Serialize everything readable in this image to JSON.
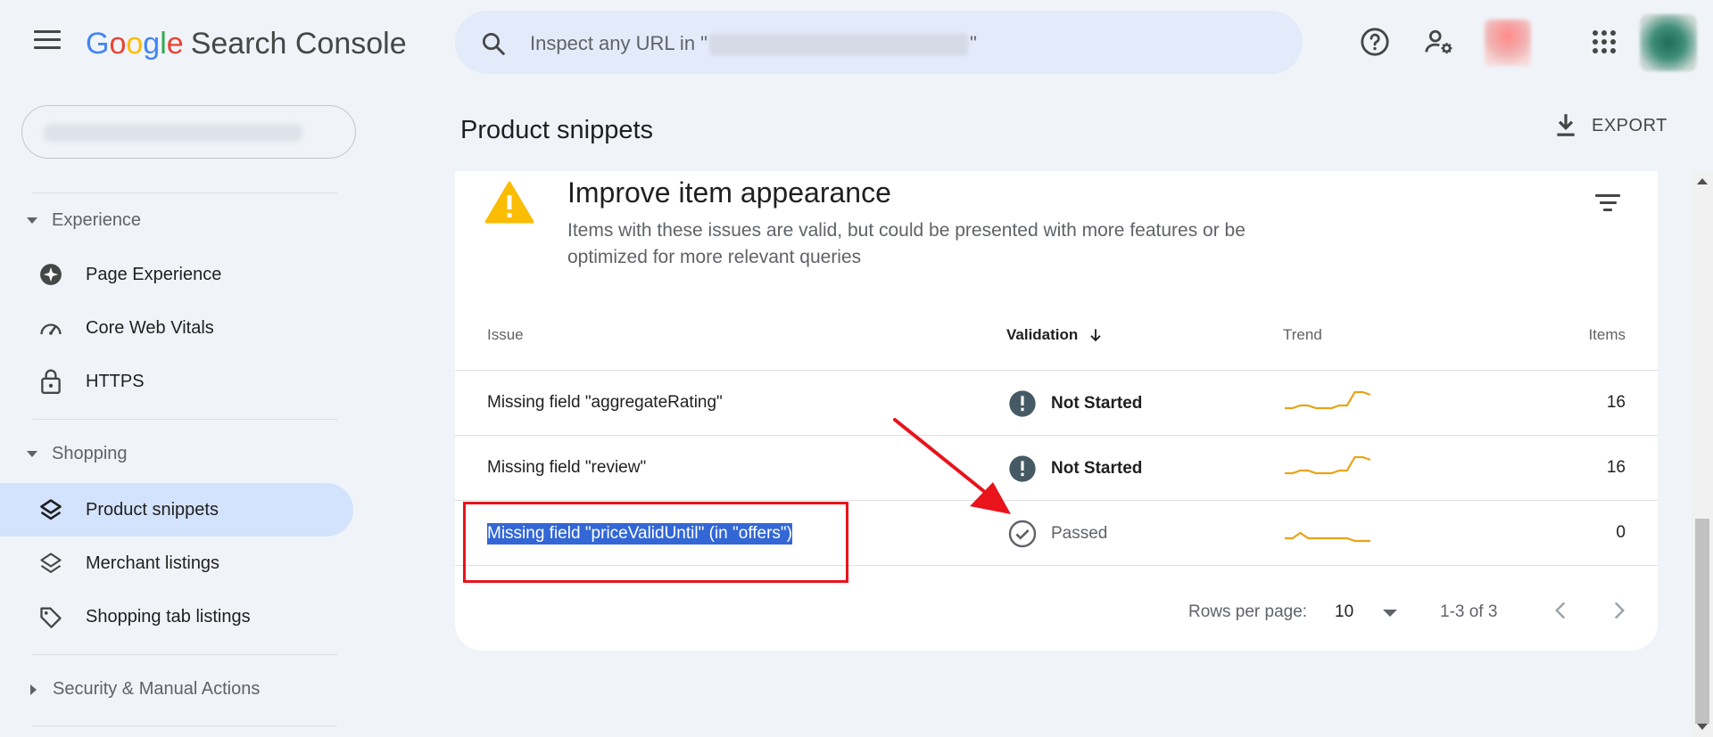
{
  "header": {
    "logo_google_letters": [
      "G",
      "o",
      "o",
      "g",
      "l",
      "e"
    ],
    "product_name": "Search Console",
    "search_placeholder_prefix": "Inspect any URL in \"",
    "search_placeholder_suffix": "\"",
    "icons": [
      "menu-icon",
      "search-icon",
      "help-icon",
      "manage-account-icon",
      "apps-icon"
    ]
  },
  "sidebar": {
    "sections": [
      {
        "label": "Experience",
        "expanded": true
      },
      {
        "label": "Shopping",
        "expanded": true
      },
      {
        "label": "Security & Manual Actions",
        "expanded": false
      }
    ],
    "items": [
      {
        "label": "Page Experience",
        "icon": "page-experience-icon",
        "active": false
      },
      {
        "label": "Core Web Vitals",
        "icon": "speedometer-icon",
        "active": false
      },
      {
        "label": "HTTPS",
        "icon": "lock-icon",
        "active": false
      },
      {
        "label": "Product snippets",
        "icon": "layers-icon",
        "active": true
      },
      {
        "label": "Merchant listings",
        "icon": "layers-outline-icon",
        "active": false
      },
      {
        "label": "Shopping tab listings",
        "icon": "tag-icon",
        "active": false
      }
    ]
  },
  "main": {
    "title": "Product snippets",
    "export_label": "EXPORT",
    "card": {
      "title": "Improve item appearance",
      "subtitle": "Items with these issues are valid, but could be presented with more features or be optimized for more relevant queries",
      "columns": {
        "issue": "Issue",
        "validation": "Validation",
        "trend": "Trend",
        "items": "Items"
      },
      "rows": [
        {
          "issue": "Missing field \"aggregateRating\"",
          "validation": "Not Started",
          "items": "16",
          "status": "warning",
          "trend": [
            3,
            3,
            4,
            4,
            3,
            3,
            3,
            4,
            4,
            9,
            9,
            8
          ]
        },
        {
          "issue": "Missing field \"review\"",
          "validation": "Not Started",
          "items": "16",
          "status": "warning",
          "trend": [
            3,
            3,
            4,
            4,
            3,
            3,
            3,
            4,
            4,
            9,
            9,
            8
          ]
        },
        {
          "issue": "Missing field \"priceValidUntil\" (in \"offers\")",
          "validation": "Passed",
          "items": "0",
          "status": "passed",
          "trend": [
            3,
            3,
            5,
            3,
            3,
            3,
            3,
            3,
            3,
            2,
            2,
            2
          ]
        }
      ],
      "pagination": {
        "rows_per_page_label": "Rows per page:",
        "rows_per_page": "10",
        "range": "1-3 of 3"
      }
    }
  },
  "colors": {
    "accent": "#d3e3fd",
    "warning": "#fbbc04",
    "trend": "#e8a317",
    "status_dark": "#455a64",
    "annotation": "#e8131b"
  }
}
